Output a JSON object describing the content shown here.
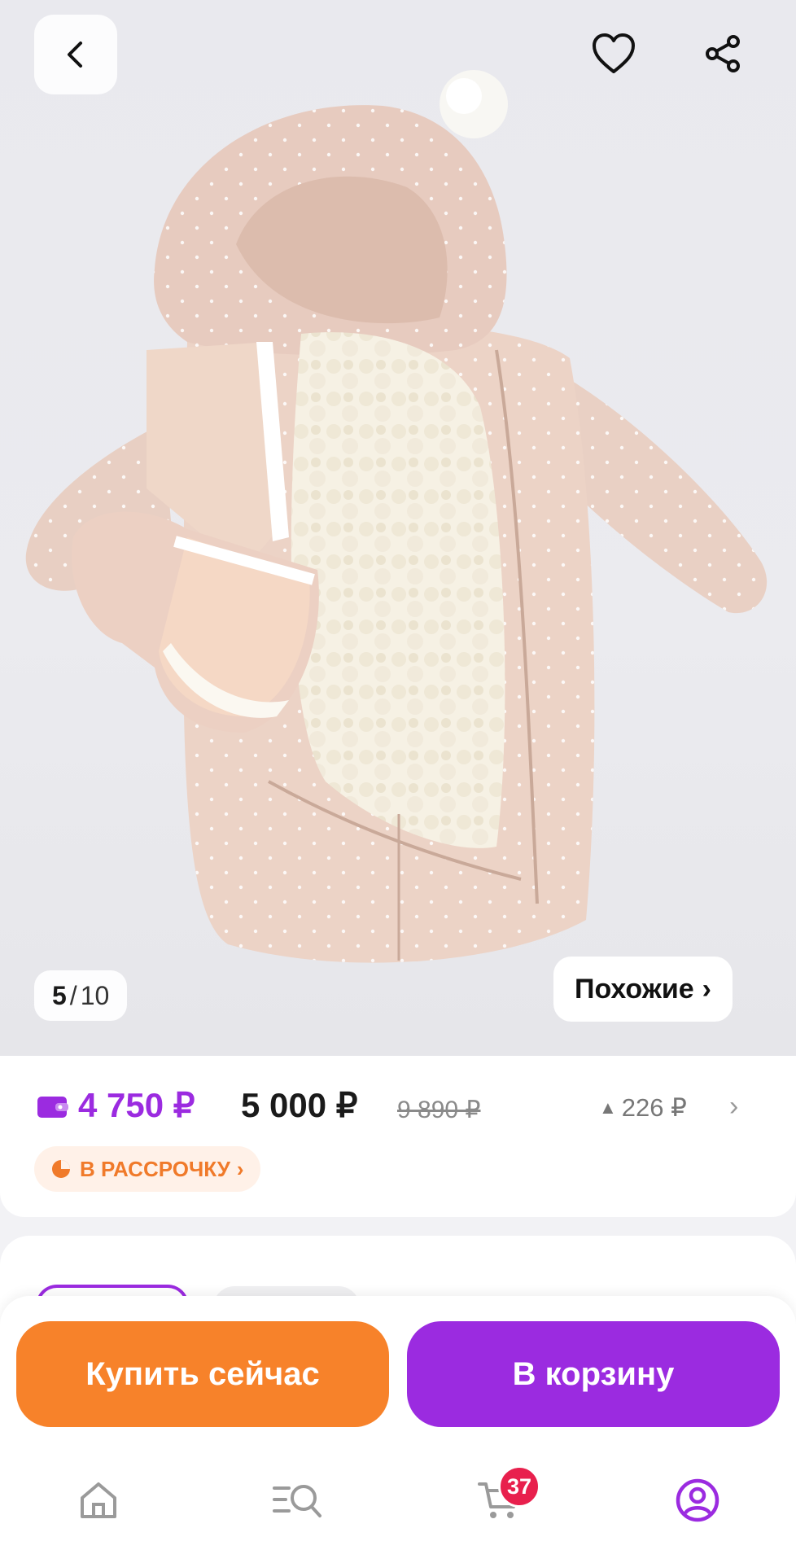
{
  "gallery": {
    "counter_current": "5",
    "counter_total": "10",
    "similar_label": "Похожие",
    "image_alt": "Pink winter baby sleeping-bag overall with sherpa lining"
  },
  "icons": {
    "back": "chevron-left-icon",
    "favorite": "heart-icon",
    "share": "share-icon",
    "wallet": "wallet-icon",
    "installment": "pie-chart-icon",
    "home": "home-icon",
    "catalog": "catalog-search-icon",
    "cart": "cart-icon",
    "profile": "profile-icon"
  },
  "price": {
    "wallet_price": "4 750 ₽",
    "price": "5 000 ₽",
    "old_price": "9 890 ₽",
    "points": "226 ₽",
    "installment_label": "В РАССРОЧКУ"
  },
  "actions": {
    "buy_now": "Купить сейчас",
    "add_to_cart": "В корзину"
  },
  "tabbar": {
    "cart_badge": "37"
  },
  "colors": {
    "accent_purple": "#9b2be0",
    "accent_orange": "#f7822a",
    "badge_red": "#e8204d"
  }
}
